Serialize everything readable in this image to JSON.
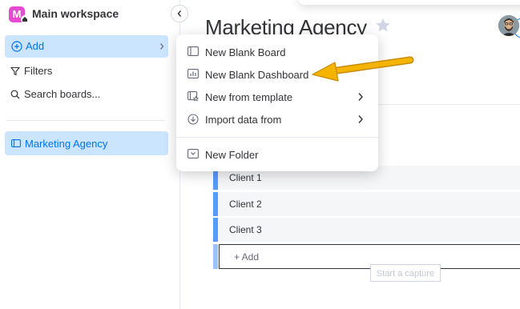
{
  "sidebar": {
    "workspace_initial": "M",
    "workspace_name": "Main workspace",
    "add_label": "Add",
    "filters_label": "Filters",
    "search_label": "Search boards...",
    "board_label": "Marketing Agency"
  },
  "main": {
    "board_title": "Marketing Agency",
    "group_rows": [
      "Client 1",
      "Client 2",
      "Client 3"
    ],
    "add_item_label": "+ Add",
    "capture_tooltip": "Start a capture"
  },
  "menu": {
    "items": [
      {
        "label": "New Blank Board",
        "icon": "board-icon"
      },
      {
        "label": "New Blank Dashboard",
        "icon": "dashboard-icon"
      },
      {
        "label": "New from template",
        "icon": "template-icon",
        "has_submenu": true
      },
      {
        "label": "Import data from",
        "icon": "import-icon",
        "has_submenu": true
      },
      {
        "label": "New Folder",
        "icon": "folder-icon"
      }
    ]
  },
  "colors": {
    "accent": "#0073ea",
    "selected_bg": "#cce5ff",
    "workspace_logo": "#e44bd1",
    "group_bar": "#579bfc",
    "annotation_arrow": "#f5b400"
  }
}
